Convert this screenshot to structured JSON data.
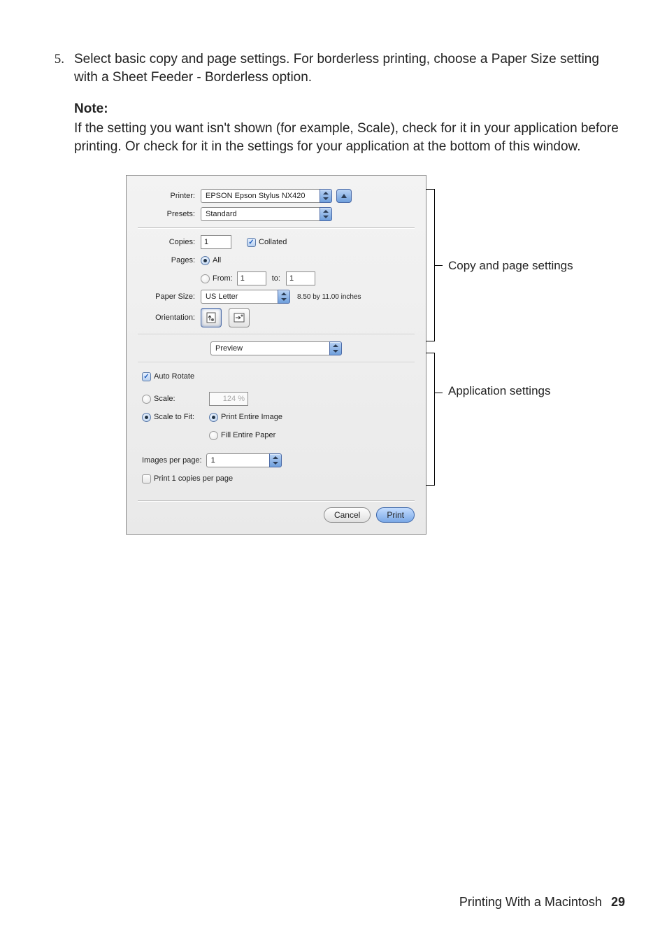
{
  "step": {
    "number": "5.",
    "text_a": "Select basic copy and page settings. For borderless printing, choose a ",
    "paper_size": "Paper Size",
    "text_b": " setting with a ",
    "sheet_feeder": "Sheet Feeder - Borderless",
    "text_c": " option."
  },
  "note": {
    "label": "Note:",
    "text_a": "If the setting you want isn't shown (for example, ",
    "scale": "Scale",
    "text_b": "), check for it in your application before printing. Or check for it in the settings for your application at the bottom of this window."
  },
  "dialog": {
    "printer_label": "Printer:",
    "printer_value": "EPSON Epson Stylus NX420",
    "presets_label": "Presets:",
    "presets_value": "Standard",
    "copies_label": "Copies:",
    "copies_value": "1",
    "collated_label": "Collated",
    "pages_label": "Pages:",
    "pages_all": "All",
    "pages_from": "From:",
    "pages_from_value": "1",
    "pages_to": "to:",
    "pages_to_value": "1",
    "paper_size_label": "Paper Size:",
    "paper_size_value": "US Letter",
    "paper_dims": "8.50 by 11.00 inches",
    "orientation_label": "Orientation:",
    "pane_value": "Preview",
    "auto_rotate": "Auto Rotate",
    "scale_label": "Scale:",
    "scale_value": "124 %",
    "scale_to_fit_label": "Scale to Fit:",
    "print_entire": "Print Entire Image",
    "fill_entire": "Fill Entire Paper",
    "images_per_page_label": "Images per page:",
    "images_per_page_value": "1",
    "print_copies": "Print 1 copies per page",
    "cancel": "Cancel",
    "print": "Print"
  },
  "callouts": {
    "copy": "Copy and page settings",
    "app": "Application settings"
  },
  "footer": {
    "title": "Printing With a Macintosh",
    "page": "29"
  }
}
